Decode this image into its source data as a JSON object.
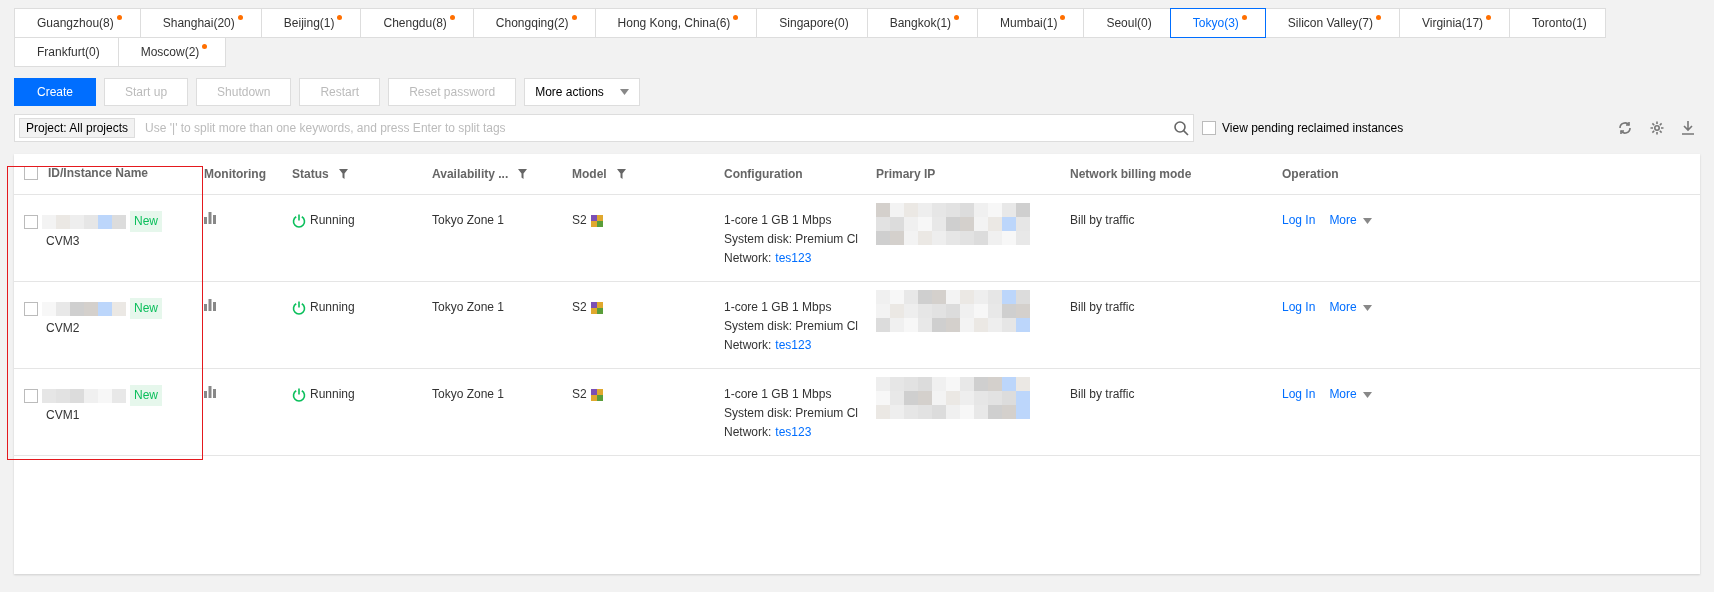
{
  "regions": [
    {
      "label": "Guangzhou(8)",
      "dot": true,
      "selected": false
    },
    {
      "label": "Shanghai(20)",
      "dot": true,
      "selected": false
    },
    {
      "label": "Beijing(1)",
      "dot": true,
      "selected": false
    },
    {
      "label": "Chengdu(8)",
      "dot": true,
      "selected": false
    },
    {
      "label": "Chongqing(2)",
      "dot": true,
      "selected": false
    },
    {
      "label": "Hong Kong, China(6)",
      "dot": true,
      "selected": false
    },
    {
      "label": "Singapore(0)",
      "dot": false,
      "selected": false
    },
    {
      "label": "Bangkok(1)",
      "dot": true,
      "selected": false
    },
    {
      "label": "Mumbai(1)",
      "dot": true,
      "selected": false
    },
    {
      "label": "Seoul(0)",
      "dot": false,
      "selected": false
    },
    {
      "label": "Tokyo(3)",
      "dot": true,
      "selected": true
    },
    {
      "label": "Silicon Valley(7)",
      "dot": true,
      "selected": false
    },
    {
      "label": "Virginia(17)",
      "dot": true,
      "selected": false
    },
    {
      "label": "Toronto(1)",
      "dot": false,
      "selected": false
    },
    {
      "label": "Frankfurt(0)",
      "dot": false,
      "selected": false
    },
    {
      "label": "Moscow(2)",
      "dot": true,
      "selected": false
    }
  ],
  "actions": [
    {
      "label": "Create",
      "kind": "primary"
    },
    {
      "label": "Start up",
      "kind": "disabled"
    },
    {
      "label": "Shutdown",
      "kind": "disabled"
    },
    {
      "label": "Restart",
      "kind": "disabled"
    },
    {
      "label": "Reset password",
      "kind": "disabled"
    },
    {
      "label": "More actions",
      "kind": "dropdown"
    }
  ],
  "search": {
    "tag": "Project: All projects",
    "placeholder": "Use '|' to split more than one keywords, and press Enter to split tags"
  },
  "pending": {
    "label": "View pending reclaimed instances",
    "checked": false
  },
  "table": {
    "select_all": false,
    "columns": [
      {
        "label": "ID/Instance Name",
        "filter": false
      },
      {
        "label": "Monitoring",
        "filter": false
      },
      {
        "label": "Status",
        "filter": true
      },
      {
        "label": "Availability ...",
        "filter": true
      },
      {
        "label": "Model",
        "filter": true
      },
      {
        "label": "Configuration",
        "filter": false
      },
      {
        "label": "Primary IP",
        "filter": false
      },
      {
        "label": "Network billing mode",
        "filter": false
      },
      {
        "label": "Operation",
        "filter": false
      }
    ],
    "rows": [
      {
        "checked": false,
        "badge": "New",
        "name": "CVM3",
        "status": "Running",
        "zone": "Tokyo Zone 1",
        "model": "S2",
        "config": [
          "1-core 1 GB 1 Mbps",
          "System disk: Premium Cl"
        ],
        "network_label": "Network:",
        "network": "tes123",
        "billing": "Bill by traffic",
        "login": "Log In",
        "more": "More"
      },
      {
        "checked": false,
        "badge": "New",
        "name": "CVM2",
        "status": "Running",
        "zone": "Tokyo Zone 1",
        "model": "S2",
        "config": [
          "1-core 1 GB 1 Mbps",
          "System disk: Premium Cl"
        ],
        "network_label": "Network:",
        "network": "tes123",
        "billing": "Bill by traffic",
        "login": "Log In",
        "more": "More"
      },
      {
        "checked": false,
        "badge": "New",
        "name": "CVM1",
        "status": "Running",
        "zone": "Tokyo Zone 1",
        "model": "S2",
        "config": [
          "1-core 1 GB 1 Mbps",
          "System disk: Premium Cl"
        ],
        "network_label": "Network:",
        "network": "tes123",
        "billing": "Bill by traffic",
        "login": "Log In",
        "more": "More"
      }
    ]
  }
}
